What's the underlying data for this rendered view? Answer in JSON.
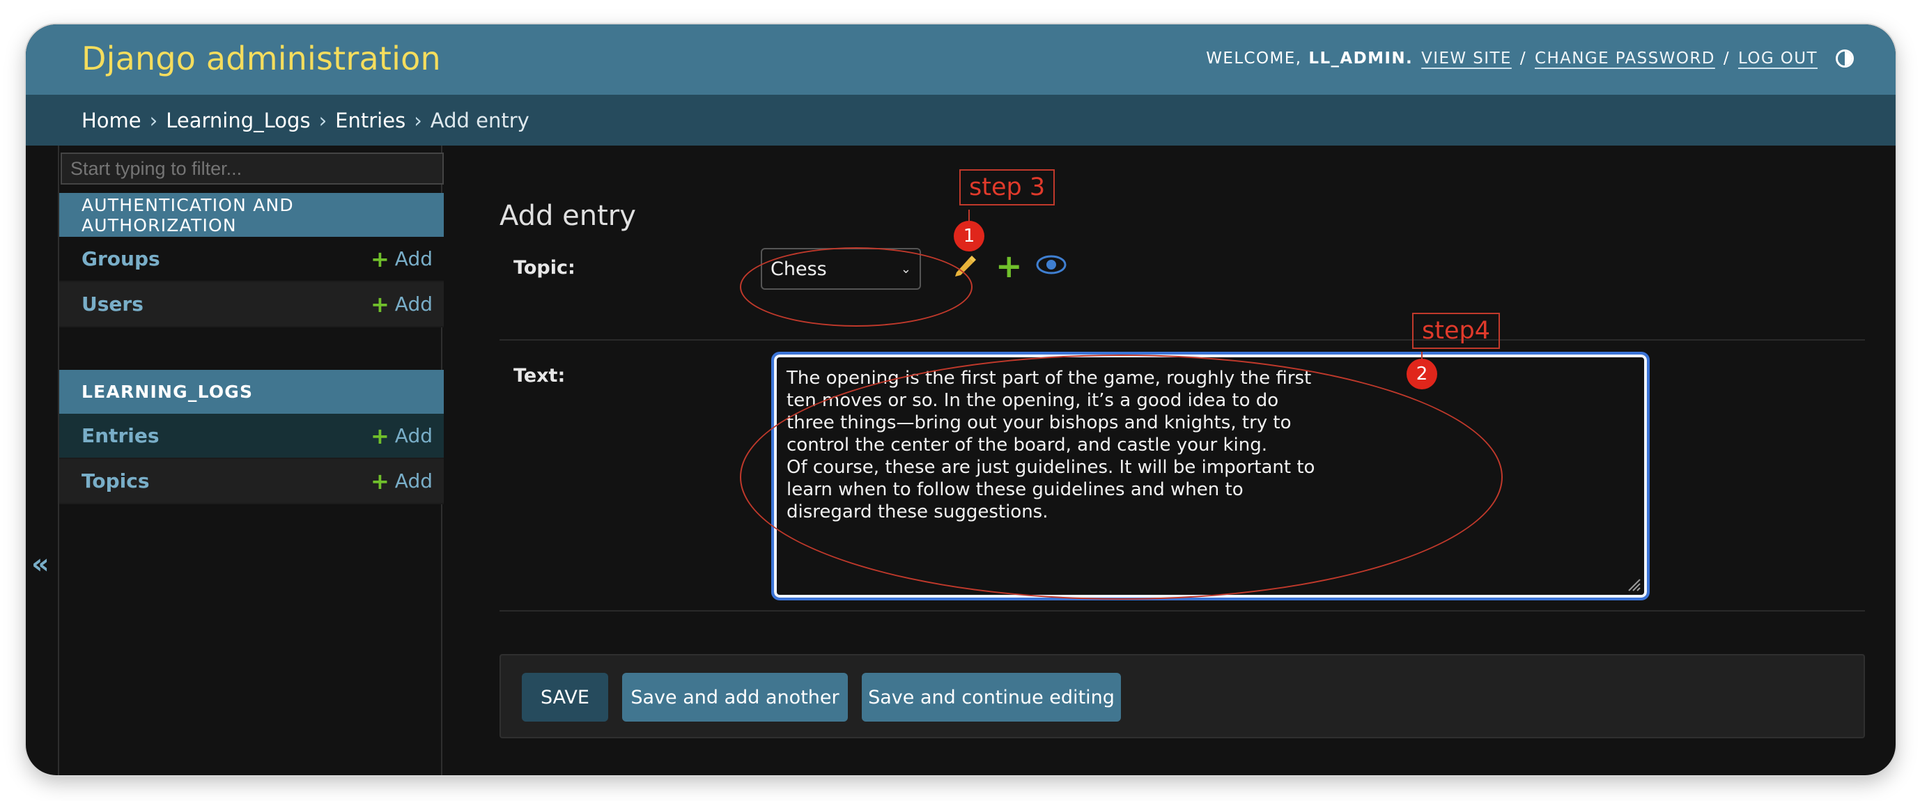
{
  "header": {
    "branding": "Django administration",
    "welcome_text": "WELCOME,",
    "username": "LL_ADMIN.",
    "view_site": "VIEW SITE",
    "change_password": "CHANGE PASSWORD",
    "log_out": "LOG OUT",
    "separator": "/"
  },
  "breadcrumbs": {
    "items": [
      "Home",
      "Learning_Logs",
      "Entries",
      "Add entry"
    ],
    "separator": "›"
  },
  "sidebar": {
    "filter_placeholder": "Start typing to filter...",
    "modules": [
      {
        "caption": "AUTHENTICATION AND AUTHORIZATION",
        "models": [
          {
            "name": "Groups",
            "add_label": "Add"
          },
          {
            "name": "Users",
            "add_label": "Add"
          }
        ]
      },
      {
        "caption": "LEARNING_LOGS",
        "models": [
          {
            "name": "Entries",
            "add_label": "Add"
          },
          {
            "name": "Topics",
            "add_label": "Add"
          }
        ]
      }
    ],
    "collapse_glyph": "«",
    "plus_glyph": "+"
  },
  "form": {
    "title": "Add entry",
    "topic_label": "Topic:",
    "topic_value": "Chess",
    "text_label": "Text:",
    "text_value_lines": [
      "The opening is the first part of the game, roughly the first ten moves or so. In the opening, it’s a good idea to do three things—bring out your bishops and knights, try to control the center of the board, and castle your king.",
      "Of course, these are just guidelines. It will be important to learn when to follow these guidelines and when to disregard these suggestions."
    ]
  },
  "submit_row": {
    "save": "SAVE",
    "save_add_another": "Save and add another",
    "save_continue": "Save and continue editing"
  },
  "annotations": {
    "step3_label": "step 3",
    "step4_label": "step4",
    "badge1": "1",
    "badge2": "2",
    "color": "#e03a2b"
  },
  "colors": {
    "header_bg": "#417690",
    "breadcrumb_bg": "#264b5d",
    "brand_text": "#f5dd5d",
    "link": "#79aec8",
    "add_plus": "#70bf2b",
    "focus_outline": "#3b74d7"
  },
  "icons": {
    "edit": "pencil-icon",
    "add": "plus-icon",
    "view": "eye-icon",
    "theme": "theme-toggle-icon",
    "collapse": "collapse-sidebar-icon"
  }
}
